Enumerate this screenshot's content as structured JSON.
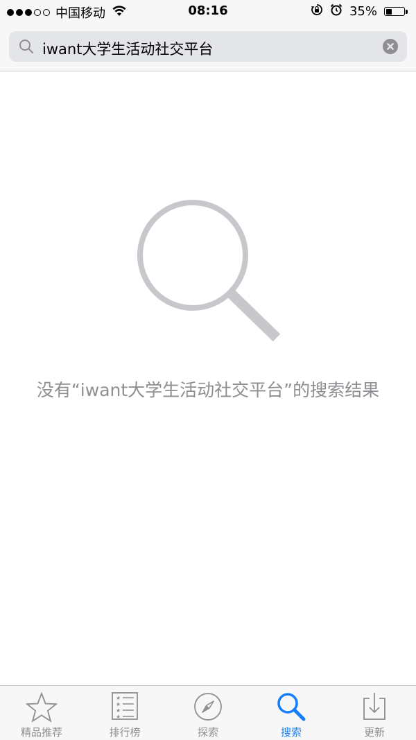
{
  "status_bar": {
    "carrier": "中国移动",
    "time": "08:16",
    "battery_percent": "35%",
    "battery_level": 0.35
  },
  "search": {
    "query": "iwant大学生活动社交平台"
  },
  "empty_state": {
    "message": "没有“iwant大学生活动社交平台”的搜索结果"
  },
  "tab_bar": {
    "tabs": [
      {
        "label": "精品推荐",
        "icon": "star-icon",
        "active": false
      },
      {
        "label": "排行榜",
        "icon": "list-icon",
        "active": false
      },
      {
        "label": "探索",
        "icon": "compass-icon",
        "active": false
      },
      {
        "label": "搜索",
        "icon": "search-icon",
        "active": true
      },
      {
        "label": "更新",
        "icon": "download-icon",
        "active": false
      }
    ],
    "active_color": "#157efb",
    "inactive_color": "#8e8e93"
  }
}
